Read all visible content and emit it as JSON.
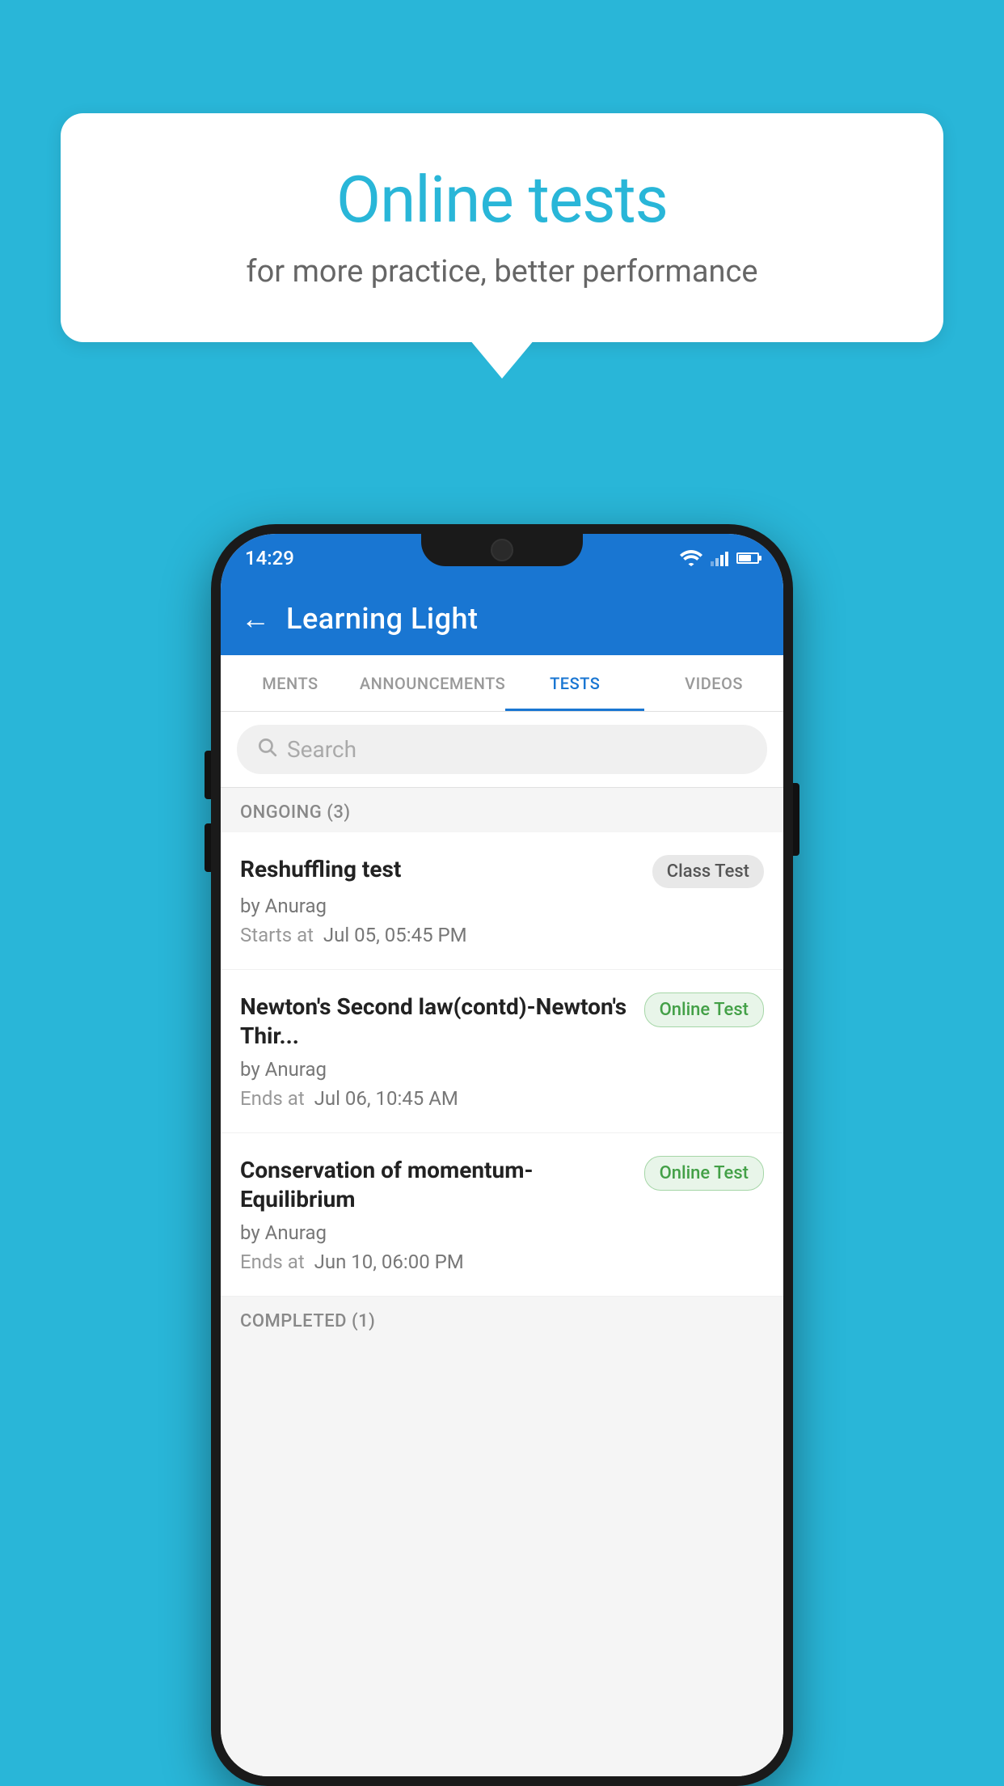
{
  "background": {
    "color": "#29b6d8"
  },
  "speech_bubble": {
    "title": "Online tests",
    "subtitle": "for more practice, better performance"
  },
  "phone": {
    "status_bar": {
      "time": "14:29"
    },
    "app_bar": {
      "title": "Learning Light"
    },
    "tabs": [
      {
        "id": "ments",
        "label": "MENTS",
        "active": false
      },
      {
        "id": "announcements",
        "label": "ANNOUNCEMENTS",
        "active": false
      },
      {
        "id": "tests",
        "label": "TESTS",
        "active": true
      },
      {
        "id": "videos",
        "label": "VIDEOS",
        "active": false
      }
    ],
    "search": {
      "placeholder": "Search"
    },
    "ongoing_section": {
      "label": "ONGOING (3)"
    },
    "test_items": [
      {
        "id": "reshuffling",
        "title": "Reshuffling test",
        "by": "by Anurag",
        "date_label": "Starts at",
        "date": "Jul 05, 05:45 PM",
        "badge": "Class Test",
        "badge_type": "class"
      },
      {
        "id": "newtons-second",
        "title": "Newton's Second law(contd)-Newton's Thir...",
        "by": "by Anurag",
        "date_label": "Ends at",
        "date": "Jul 06, 10:45 AM",
        "badge": "Online Test",
        "badge_type": "online"
      },
      {
        "id": "conservation",
        "title": "Conservation of momentum-Equilibrium",
        "by": "by Anurag",
        "date_label": "Ends at",
        "date": "Jun 10, 06:00 PM",
        "badge": "Online Test",
        "badge_type": "online"
      }
    ],
    "completed_section": {
      "label": "COMPLETED (1)"
    }
  }
}
